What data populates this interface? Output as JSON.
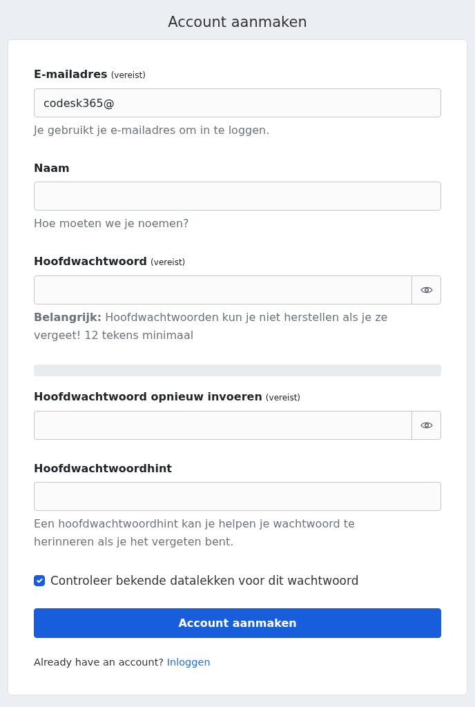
{
  "title": "Account aanmaken",
  "fields": [
    {
      "kind": "text",
      "label": "E-mailadres",
      "required_note": "(vereist)",
      "value": "codesk365@",
      "help": "Je gebruikt je e-mailadres om in te loggen."
    },
    {
      "kind": "text",
      "label": "Naam",
      "help": "Hoe moeten we je noemen?"
    },
    {
      "kind": "password",
      "label": "Hoofdwachtwoord",
      "required_note": "(vereist)",
      "help": "**Belangrijk:** Hoofdwachtwoorden kun je niet herstellen als je ze vergeet! 12 tekens minimaal"
    },
    {
      "kind": "meter",
      "level": 0
    },
    {
      "kind": "password",
      "label": "Hoofdwachtwoord opnieuw invoeren",
      "required_note": "(vereist)"
    },
    {
      "kind": "text",
      "label": "Hoofdwachtwoordhint",
      "help": "Een hoofdwachtwoordhint kan je helpen je wachtwoord te herinneren als je het vergeten bent."
    }
  ],
  "checkbox": {
    "label": "Controleer bekende datalekken voor dit wachtwoord",
    "checked": true
  },
  "submit_button": "Account aanmaken",
  "footer": {
    "text": "Already have an account?",
    "link": "Inloggen"
  }
}
